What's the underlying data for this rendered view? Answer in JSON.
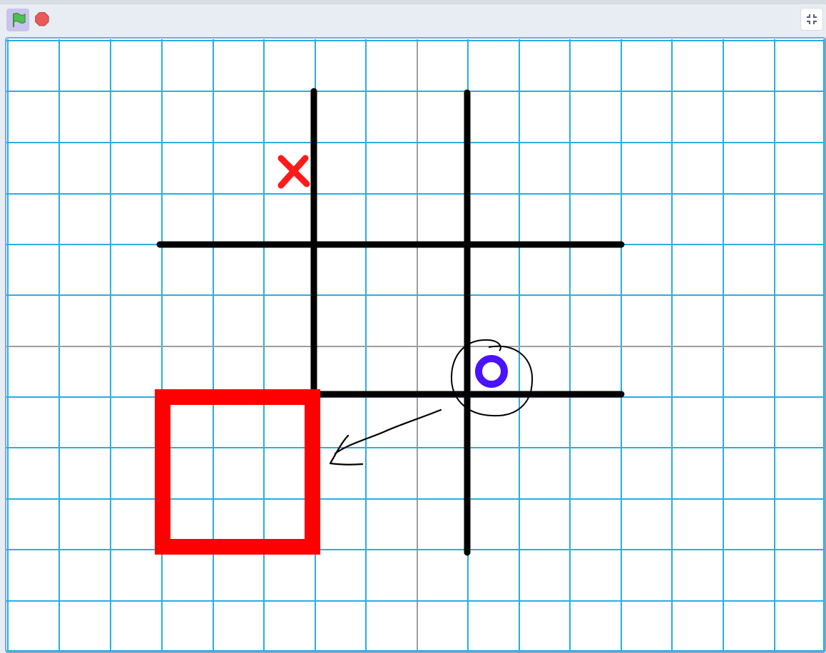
{
  "toolbar": {
    "green_flag_icon": "green-flag-icon",
    "stop_icon": "stop-icon",
    "fullscreen_icon": "exit-fullscreen-icon"
  },
  "stage": {
    "background": "blue-grid",
    "grid_color": "#29aee0",
    "axis_color": "#9e9e9e",
    "board_line_color": "#000000",
    "x_mark_color": "#ff1a1a",
    "o_mark_color": "#4a12ff",
    "highlight_box_color": "#ff0000",
    "annotation_color": "#000000"
  },
  "board": {
    "marks": [
      {
        "symbol": "X",
        "cell": "top-left"
      },
      {
        "symbol": "O",
        "cell": "center-right-bottom",
        "circled": true
      }
    ]
  }
}
